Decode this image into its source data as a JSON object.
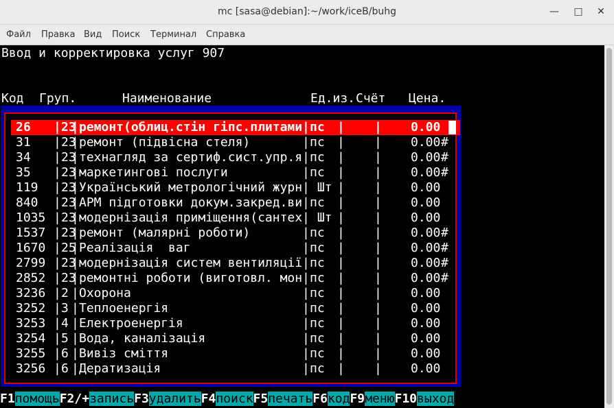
{
  "window": {
    "title": "mc [sasa@debian]:~/work/iceB/buhg"
  },
  "menu": [
    "Файл",
    "Правка",
    "Вид",
    "Поиск",
    "Терминал",
    "Справка"
  ],
  "screen_title": "Ввод и корректировка услуг 907",
  "headers": {
    "kod": "Код",
    "grup": "Груп.",
    "name": "Наименование",
    "ed": "Ед.из.",
    "schet": "Счёт",
    "price": "Цена."
  },
  "rows": [
    {
      "kod": "26",
      "grup": "23",
      "name": "ремонт(облиц.стін гіпс.плитами",
      "ed": "пс",
      "price": "0.00",
      "flag": ""
    },
    {
      "kod": "31",
      "grup": "23",
      "name": "ремонт (підвісна стеля)",
      "ed": "пс",
      "price": "0.00",
      "flag": "#"
    },
    {
      "kod": "34",
      "grup": "23",
      "name": "технагляд за сертиф.сист.упр.я",
      "ed": "пс",
      "price": "0.00",
      "flag": "#"
    },
    {
      "kod": "35",
      "grup": "23",
      "name": "маркетингові послуги",
      "ed": "пс",
      "price": "0.00",
      "flag": "#"
    },
    {
      "kod": "119",
      "grup": "23",
      "name": "Український метрологічний журн",
      "ed": " Шт",
      "price": "0.00",
      "flag": ""
    },
    {
      "kod": "840",
      "grup": "23",
      "name": "АРМ підготовки докум.закред.ви",
      "ed": "пс",
      "price": "0.00",
      "flag": ""
    },
    {
      "kod": "1035",
      "grup": "23",
      "name": "модернізація приміщення(сантех",
      "ed": " Шт",
      "price": "0.00",
      "flag": ""
    },
    {
      "kod": "1537",
      "grup": "23",
      "name": "ремонт (малярні роботи)",
      "ed": "пс",
      "price": "0.00",
      "flag": "#"
    },
    {
      "kod": "1670",
      "grup": "25",
      "name": "Реалізація  ваг",
      "ed": "пс",
      "price": "0.00",
      "flag": "#"
    },
    {
      "kod": "2799",
      "grup": "23",
      "name": "модернізація систем вентиляції",
      "ed": "пс",
      "price": "0.00",
      "flag": "#"
    },
    {
      "kod": "2852",
      "grup": "23",
      "name": "ремонтні роботи (виготовл. мон",
      "ed": "пс",
      "price": "0.00",
      "flag": "#"
    },
    {
      "kod": "3236",
      "grup": "2",
      "name": "Охорона",
      "ed": "пс",
      "price": "0.00",
      "flag": ""
    },
    {
      "kod": "3252",
      "grup": "3",
      "name": "Теплоенергія",
      "ed": "пс",
      "price": "0.00",
      "flag": ""
    },
    {
      "kod": "3253",
      "grup": "4",
      "name": "Електроенергія",
      "ed": "пс",
      "price": "0.00",
      "flag": ""
    },
    {
      "kod": "3254",
      "grup": "5",
      "name": "Вода, каналізація",
      "ed": "пс",
      "price": "0.00",
      "flag": ""
    },
    {
      "kod": "3255",
      "grup": "6",
      "name": "Вивіз сміття",
      "ed": "пс",
      "price": "0.00",
      "flag": ""
    },
    {
      "kod": "3256",
      "grup": "6",
      "name": "Дератизація",
      "ed": "пс",
      "price": "0.00",
      "flag": ""
    }
  ],
  "fkeys": [
    {
      "key": "F1",
      "label": "помощь"
    },
    {
      "key": "F2/+",
      "label": "запись"
    },
    {
      "key": "F3",
      "label": "удалить"
    },
    {
      "key": "F4",
      "label": "поиск"
    },
    {
      "key": "F5",
      "label": "печать"
    },
    {
      "key": "F6",
      "label": "код"
    },
    {
      "key": "F9",
      "label": "меню"
    },
    {
      "key": "F10",
      "label": "выход"
    }
  ],
  "colors": {
    "dialog_bg": "#0000aa",
    "selected_row": "#ff0000",
    "fkey_label_bg": "#00aaaa"
  }
}
